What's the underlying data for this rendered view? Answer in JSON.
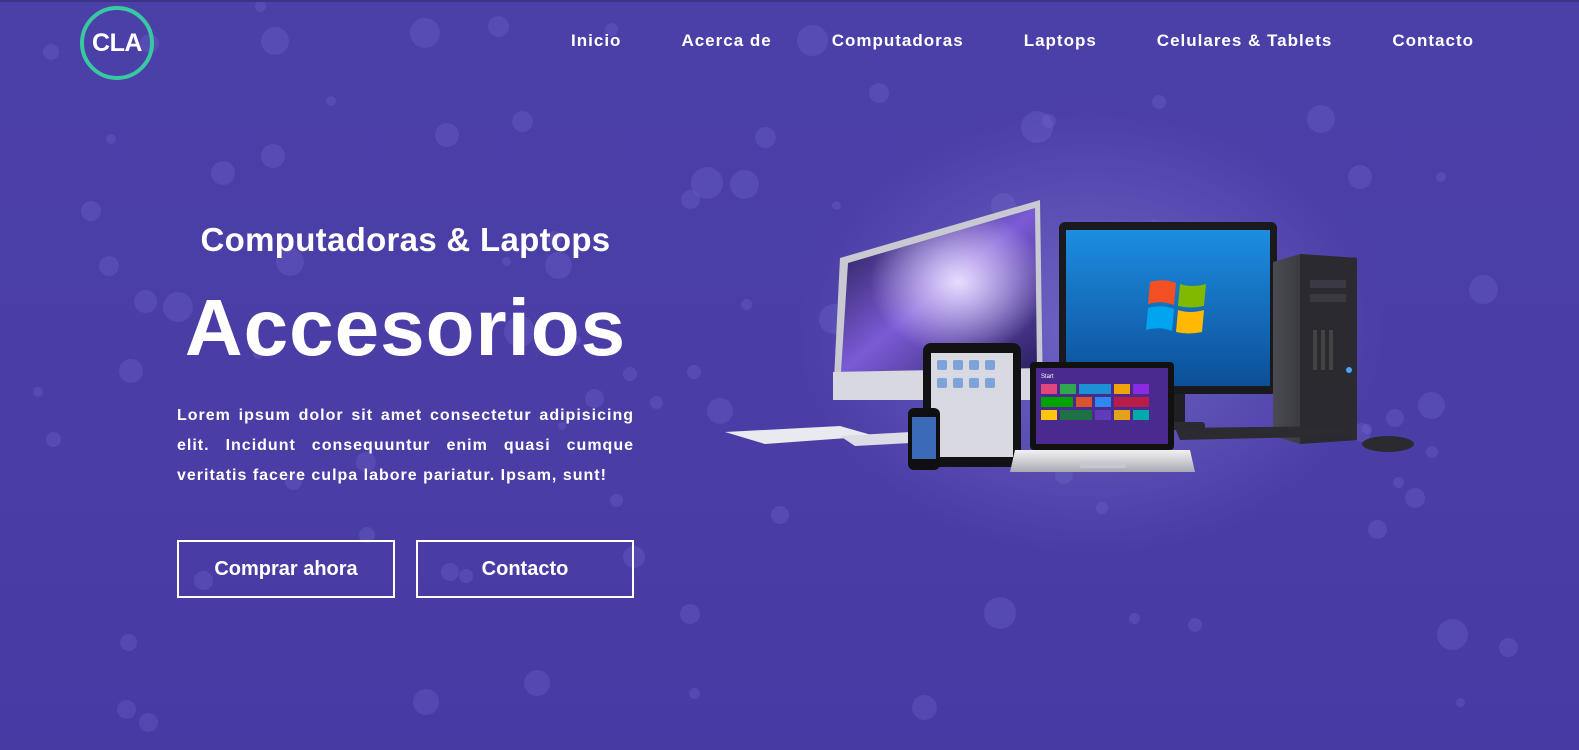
{
  "brand": {
    "logo_text": "CLA",
    "accent": "#38c9a0",
    "background": "#4a3ea6"
  },
  "nav": {
    "items": [
      {
        "label": "Inicio"
      },
      {
        "label": "Acerca de"
      },
      {
        "label": "Computadoras"
      },
      {
        "label": "Laptops"
      },
      {
        "label": "Celulares & Tablets"
      },
      {
        "label": "Contacto"
      }
    ]
  },
  "hero": {
    "subtitle": "Computadoras & Laptops",
    "title": "Accesorios",
    "description": "Lorem ipsum dolor sit amet consectetur adipisicing elit. Incidunt consequuntur enim quasi cumque veritatis facere culpa labore pariatur. Ipsam, sunt!",
    "buttons": {
      "primary": "Comprar ahora",
      "secondary": "Contacto"
    },
    "image": {
      "icon": "devices-illustration",
      "laptop_screen_label": "Start"
    }
  }
}
